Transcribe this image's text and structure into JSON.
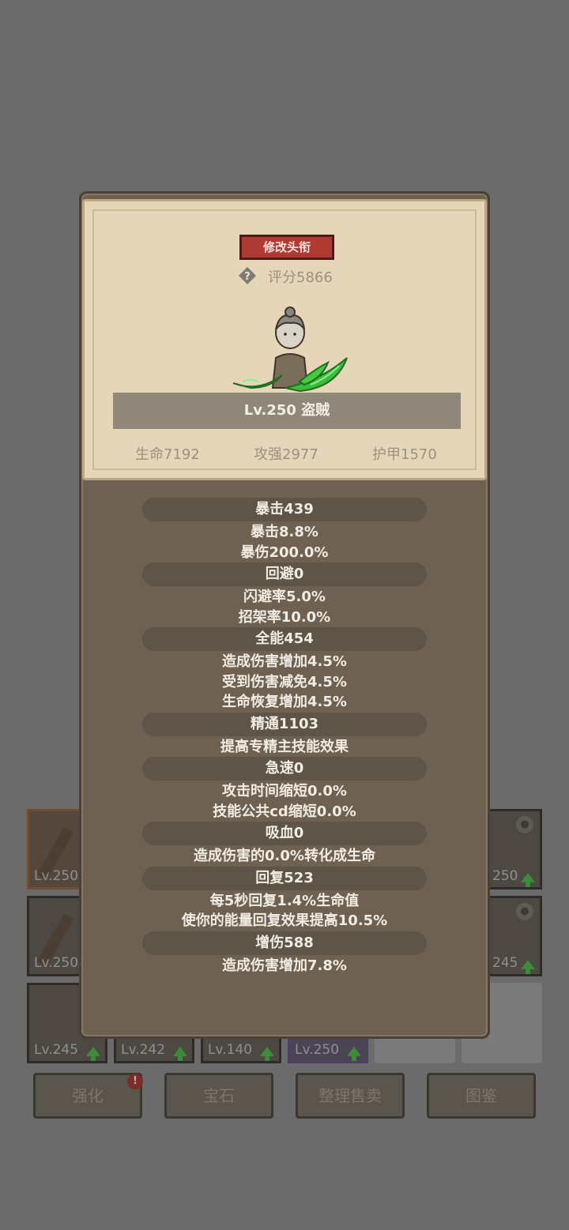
{
  "popup": {
    "title_button": "修改头衔",
    "score": "评分5866",
    "hero_name": "Lv.250 盗贼",
    "stats": {
      "life": "生命7192",
      "attack": "攻强2977",
      "armor": "护甲1570"
    },
    "groups": [
      {
        "header": "暴击439",
        "lines": [
          "暴击8.8%",
          "暴伤200.0%"
        ]
      },
      {
        "header": "回避0",
        "lines": [
          "闪避率5.0%",
          "招架率10.0%"
        ]
      },
      {
        "header": "全能454",
        "lines": [
          "造成伤害增加4.5%",
          "受到伤害减免4.5%",
          "生命恢复增加4.5%"
        ]
      },
      {
        "header": "精通1103",
        "lines": [
          "提高专精主技能效果"
        ]
      },
      {
        "header": "急速0",
        "lines": [
          "攻击时间缩短0.0%",
          "技能公共cd缩短0.0%"
        ]
      },
      {
        "header": "吸血0",
        "lines": [
          "造成伤害的0.0%转化成生命"
        ]
      },
      {
        "header": "回复523",
        "lines": [
          "每5秒回复1.4%生命值",
          "使你的能量回复效果提高10.5%"
        ]
      },
      {
        "header": "增伤588",
        "lines": [
          "造成伤害增加7.8%"
        ]
      }
    ]
  },
  "inventory": {
    "slots": [
      {
        "level": "Lv.250"
      },
      {
        "level": "250"
      },
      {
        "level": "Lv.250"
      },
      {
        "level": "245"
      },
      {
        "level": "Lv.245"
      },
      {
        "level": "Lv.242"
      },
      {
        "level": "Lv.140"
      },
      {
        "level": "Lv.250"
      }
    ]
  },
  "bottom_buttons": {
    "enhance": "强化",
    "gem": "宝石",
    "sort_sell": "整理售卖",
    "codex": "图鉴",
    "badge": "!"
  }
}
